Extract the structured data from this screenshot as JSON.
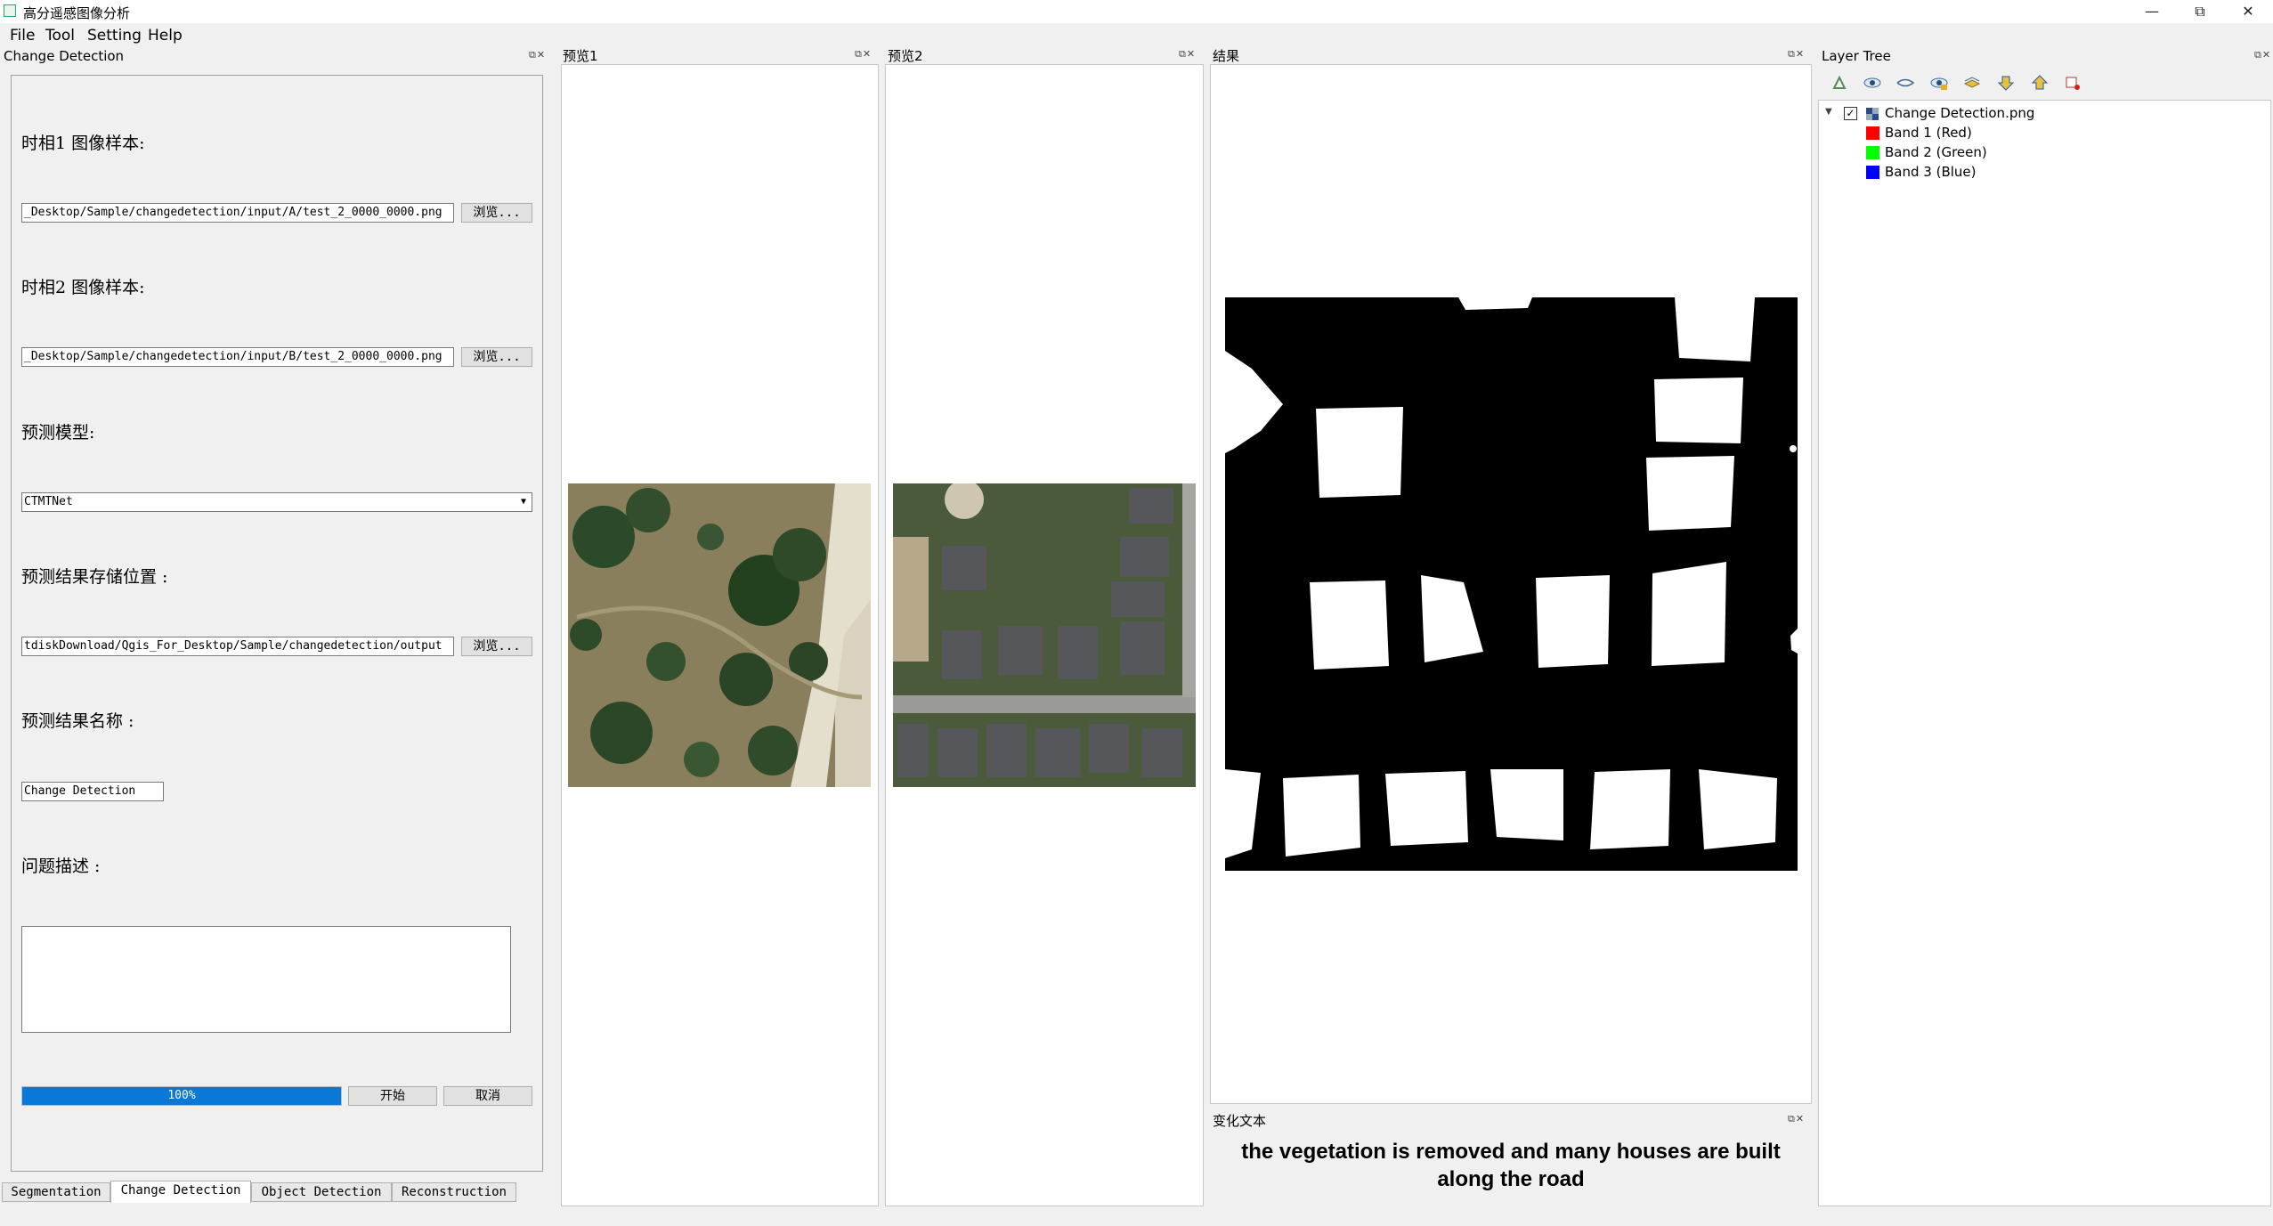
{
  "window": {
    "title": "高分遥感图像分析",
    "controls": {
      "minimize": "—",
      "restore": "⧉",
      "close": "✕"
    }
  },
  "menu": [
    "File",
    "Tool",
    "Setting",
    "Help"
  ],
  "left_dock": {
    "title": "Change Detection",
    "fields": {
      "t1_label": "时相1 图像样本:",
      "t1_path": "_Desktop/Sample/changedetection/input/A/test_2_0000_0000.png",
      "t2_label": "时相2 图像样本:",
      "t2_path": "_Desktop/Sample/changedetection/input/B/test_2_0000_0000.png",
      "model_label": "预测模型:",
      "model_value": "CTMTNet",
      "out_label": "预测结果存储位置 :",
      "out_path": "tdiskDownload/Qgis_For_Desktop/Sample/changedetection/output",
      "name_label": "预测结果名称 :",
      "name_value": "Change Detection",
      "desc_label": "问题描述 :",
      "desc_value": ""
    },
    "browse_label": "浏览...",
    "progress": {
      "percent": 100,
      "label": "100%"
    },
    "start_label": "开始",
    "cancel_label": "取消"
  },
  "bottom_tabs": [
    "Segmentation",
    "Change Detection",
    "Object Detection",
    "Reconstruction"
  ],
  "active_tab": "Change Detection",
  "preview1": {
    "title": "预览1"
  },
  "preview2": {
    "title": "预览2"
  },
  "result": {
    "title": "结果"
  },
  "change_text": {
    "title": "变化文本",
    "text": "the vegetation is removed and many houses are built along the road"
  },
  "layer_tree": {
    "title": "Layer Tree",
    "toolbar_icons": [
      "add-layer-icon",
      "eye-icon",
      "eye-closed-icon",
      "eye-filter-icon",
      "layer-style-icon",
      "move-down-icon",
      "move-up-icon",
      "remove-layer-icon"
    ],
    "root": {
      "label": "Change Detection.png",
      "checked": true
    },
    "bands": [
      {
        "label": "Band 1 (Red)",
        "color": "#ff0000"
      },
      {
        "label": "Band 2 (Green)",
        "color": "#00ff00"
      },
      {
        "label": "Band 3 (Blue)",
        "color": "#0000ff"
      }
    ]
  },
  "colors": {
    "progress": "#0a78d7",
    "accent": "#2a6"
  }
}
